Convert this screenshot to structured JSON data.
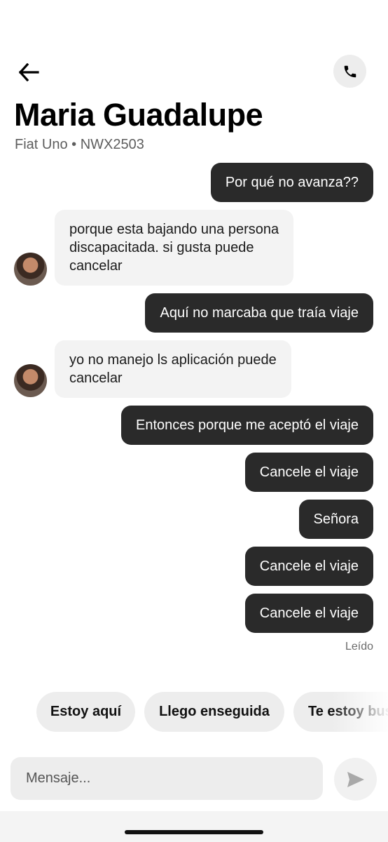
{
  "header": {
    "back_icon": "arrow-left-icon",
    "call_icon": "phone-icon",
    "title": "Maria Guadalupe",
    "subtitle": "Fiat Uno • NWX2503"
  },
  "messages": [
    {
      "direction": "sent",
      "text": "Por qué no avanza??"
    },
    {
      "direction": "received",
      "line1": "porque esta bajando una persona",
      "line2": "discapacitada. si gusta puede",
      "line3": "cancelar"
    },
    {
      "direction": "sent",
      "text": "Aquí no marcaba que traía viaje"
    },
    {
      "direction": "received",
      "line1": "yo no manejo ls aplicación puede",
      "line2": "cancelar"
    },
    {
      "direction": "sent",
      "text": "Entonces porque me aceptó el viaje"
    },
    {
      "direction": "sent",
      "text": "Cancele el viaje"
    },
    {
      "direction": "sent",
      "text": "Señora"
    },
    {
      "direction": "sent",
      "text": "Cancele el viaje"
    },
    {
      "direction": "sent",
      "text": "Cancele el viaje"
    }
  ],
  "read_status": "Leído",
  "quick_replies": [
    "Estoy aquí",
    "Llego enseguida",
    "Te estoy buscando"
  ],
  "composer": {
    "placeholder": "Mensaje...",
    "send_icon": "send-icon"
  },
  "colors": {
    "sent_bubble": "#2a2a2a",
    "received_bubble": "#f3f3f3",
    "chip": "#ededed"
  }
}
